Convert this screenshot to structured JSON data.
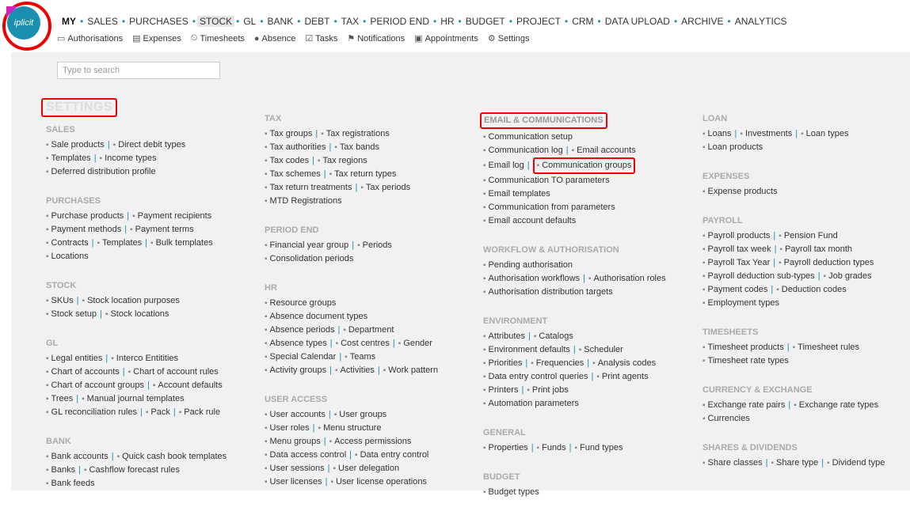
{
  "logo": {
    "text": "iplicit",
    "badge": "alt"
  },
  "topnav": [
    "MY",
    "SALES",
    "PURCHASES",
    "STOCK",
    "GL",
    "BANK",
    "DEBT",
    "TAX",
    "PERIOD END",
    "HR",
    "BUDGET",
    "PROJECT",
    "CRM",
    "DATA UPLOAD",
    "ARCHIVE",
    "ANALYTICS"
  ],
  "subnav": [
    {
      "label": "Authorisations",
      "icon": "authorisations-icon"
    },
    {
      "label": "Expenses",
      "icon": "expenses-icon"
    },
    {
      "label": "Timesheets",
      "icon": "timesheets-icon"
    },
    {
      "label": "Absence",
      "icon": "absence-icon"
    },
    {
      "label": "Tasks",
      "icon": "tasks-icon"
    },
    {
      "label": "Notifications",
      "icon": "flag-icon"
    },
    {
      "label": "Appointments",
      "icon": "calendar-icon"
    },
    {
      "label": "Settings",
      "icon": "gear-icon"
    }
  ],
  "search": {
    "placeholder": "Type to search"
  },
  "page_title": "SETTINGS",
  "columns": [
    [
      {
        "title": "SALES",
        "lines": [
          [
            "Sale products",
            "Direct debit types"
          ],
          [
            "Templates",
            "Income types"
          ],
          [
            "Deferred distribution profile"
          ]
        ]
      },
      {
        "title": "PURCHASES",
        "lines": [
          [
            "Purchase products",
            "Payment recipients"
          ],
          [
            "Payment methods",
            "Payment terms"
          ],
          [
            "Contracts",
            "Templates",
            "Bulk templates"
          ],
          [
            "Locations"
          ]
        ]
      },
      {
        "title": "STOCK",
        "lines": [
          [
            "SKUs",
            "Stock location purposes"
          ],
          [
            "Stock setup",
            "Stock locations"
          ]
        ]
      },
      {
        "title": "GL",
        "lines": [
          [
            "Legal entities",
            "Interco Entitities"
          ],
          [
            "Chart of accounts",
            "Chart of account rules"
          ],
          [
            "Chart of account groups",
            "Account defaults"
          ],
          [
            "Trees",
            "Manual journal templates"
          ],
          [
            "GL reconciliation rules",
            "Pack",
            "Pack rule"
          ]
        ]
      },
      {
        "title": "BANK",
        "lines": [
          [
            "Bank accounts",
            "Quick cash book templates"
          ],
          [
            "Banks",
            "Cashflow forecast rules"
          ],
          [
            "Bank feeds"
          ]
        ]
      }
    ],
    [
      {
        "title": "TAX",
        "lines": [
          [
            "Tax groups",
            "Tax registrations"
          ],
          [
            "Tax authorities",
            "Tax bands"
          ],
          [
            "Tax codes",
            "Tax regions"
          ],
          [
            "Tax schemes",
            "Tax return types"
          ],
          [
            "Tax return treatments",
            "Tax periods"
          ],
          [
            "MTD Registrations"
          ]
        ]
      },
      {
        "title": "PERIOD END",
        "lines": [
          [
            "Financial year group",
            "Periods"
          ],
          [
            "Consolidation periods"
          ]
        ]
      },
      {
        "title": "HR",
        "lines": [
          [
            "Resource groups"
          ],
          [
            "Absence document types"
          ],
          [
            "Absence periods",
            "Department"
          ],
          [
            "Absence types",
            "Cost centres",
            "Gender"
          ],
          [
            "Special Calendar",
            "Teams"
          ],
          [
            "Activity groups",
            "Activities",
            "Work pattern"
          ]
        ]
      },
      {
        "title": "USER ACCESS",
        "lines": [
          [
            "User accounts",
            "User groups"
          ],
          [
            "User roles",
            "Menu structure"
          ],
          [
            "Menu groups",
            "Access permissions"
          ],
          [
            "Data access control",
            "Data entry control"
          ],
          [
            "User sessions",
            "User delegation"
          ],
          [
            "User licenses",
            "User license operations"
          ]
        ]
      }
    ],
    [
      {
        "title": "EMAIL & COMMUNICATIONS",
        "lines": [
          [
            "Communication setup"
          ],
          [
            "Communication log",
            "Email accounts"
          ],
          [
            "Email log",
            "Communication groups"
          ],
          [
            "Communication TO parameters"
          ],
          [
            "Email templates"
          ],
          [
            "Communication from parameters"
          ],
          [
            "Email account defaults"
          ]
        ]
      },
      {
        "title": "WORKFLOW & AUTHORISATION",
        "lines": [
          [
            "Pending authorisation"
          ],
          [
            "Authorisation workflows",
            "Authorisation roles"
          ],
          [
            "Authorisation distribution targets"
          ]
        ]
      },
      {
        "title": "ENVIRONMENT",
        "lines": [
          [
            "Attributes",
            "Catalogs"
          ],
          [
            "Environment defaults",
            "Scheduler"
          ],
          [
            "Priorities",
            "Frequencies",
            "Analysis codes"
          ],
          [
            "Data entry control queries",
            "Print agents"
          ],
          [
            "Printers",
            "Print jobs"
          ],
          [
            "Automation parameters"
          ]
        ]
      },
      {
        "title": "GENERAL",
        "lines": [
          [
            "Properties",
            "Funds",
            "Fund types"
          ]
        ]
      },
      {
        "title": "BUDGET",
        "lines": [
          [
            "Budget types"
          ]
        ]
      }
    ],
    [
      {
        "title": "LOAN",
        "lines": [
          [
            "Loans",
            "Investments",
            "Loan types"
          ],
          [
            "Loan products"
          ]
        ]
      },
      {
        "title": "EXPENSES",
        "lines": [
          [
            "Expense products"
          ]
        ]
      },
      {
        "title": "PAYROLL",
        "lines": [
          [
            "Payroll products",
            "Pension Fund"
          ],
          [
            "Payroll tax week",
            "Payroll tax month"
          ],
          [
            "Payroll Tax Year",
            "Payroll deduction types"
          ],
          [
            "Payroll deduction sub-types",
            "Job grades"
          ],
          [
            "Payment codes",
            "Deduction codes"
          ],
          [
            "Employment types"
          ]
        ]
      },
      {
        "title": "TIMESHEETS",
        "lines": [
          [
            "Timesheet products",
            "Timesheet rules"
          ],
          [
            "Timesheet rate types"
          ]
        ]
      },
      {
        "title": "CURRENCY & EXCHANGE",
        "lines": [
          [
            "Exchange rate pairs",
            "Exchange rate types"
          ],
          [
            "Currencies"
          ]
        ]
      },
      {
        "title": "SHARES & DIVIDENDS",
        "lines": [
          [
            "Share classes",
            "Share type",
            "Dividend type"
          ]
        ]
      }
    ]
  ],
  "highlighted": {
    "section": "EMAIL & COMMUNICATIONS",
    "link": "Communication groups"
  },
  "colors": {
    "accent": "#1a8fb0",
    "highlight": "#e00000",
    "brand_pink": "#d41fbe"
  }
}
